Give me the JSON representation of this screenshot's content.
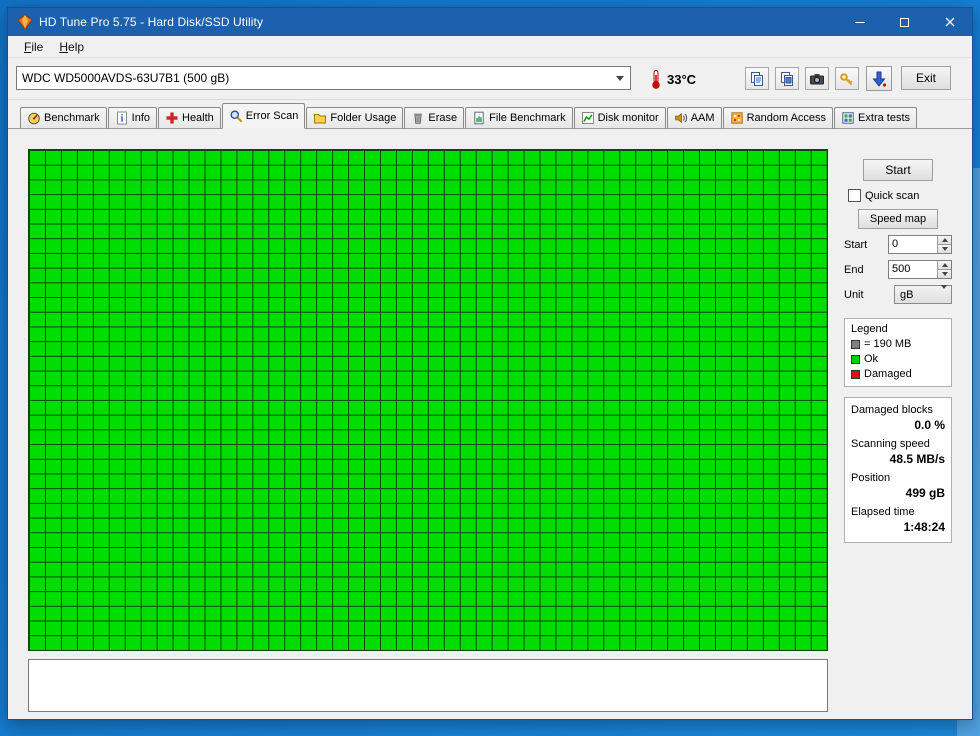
{
  "window": {
    "title": "HD Tune Pro 5.75 - Hard Disk/SSD Utility",
    "controls": [
      "minimize",
      "maximize",
      "close"
    ]
  },
  "menu": {
    "items": [
      {
        "label": "File"
      },
      {
        "label": "Help"
      }
    ]
  },
  "toolbar": {
    "drive_select_value": "WDC WD5000AVDS-63U7B1 (500 gB)",
    "temperature": "33°C",
    "icon_buttons": [
      "copy-text-icon",
      "copy-image-icon",
      "camera-icon",
      "key-icon",
      "download-arrow-icon"
    ],
    "exit_label": "Exit"
  },
  "tabs": [
    {
      "label": "Benchmark",
      "icon": "benchmark-icon",
      "active": false
    },
    {
      "label": "Info",
      "icon": "info-icon",
      "active": false
    },
    {
      "label": "Health",
      "icon": "health-icon",
      "active": false
    },
    {
      "label": "Error Scan",
      "icon": "error-scan-icon",
      "active": true
    },
    {
      "label": "Folder Usage",
      "icon": "folder-icon",
      "active": false
    },
    {
      "label": "Erase",
      "icon": "erase-icon",
      "active": false
    },
    {
      "label": "File Benchmark",
      "icon": "file-benchmark-icon",
      "active": false
    },
    {
      "label": "Disk monitor",
      "icon": "disk-monitor-icon",
      "active": false
    },
    {
      "label": "AAM",
      "icon": "speaker-icon",
      "active": false
    },
    {
      "label": "Random Access",
      "icon": "random-access-icon",
      "active": false
    },
    {
      "label": "Extra tests",
      "icon": "extra-tests-icon",
      "active": false
    }
  ],
  "scan_controls": {
    "start_button": "Start",
    "quick_scan_label": "Quick scan",
    "quick_scan_checked": false,
    "speed_map_button": "Speed map",
    "range_start_label": "Start",
    "range_start_value": "0",
    "range_end_label": "End",
    "range_end_value": "500",
    "unit_label": "Unit",
    "unit_value": "gB"
  },
  "legend": {
    "title": "Legend",
    "items": [
      {
        "label": "= 190 MB",
        "color": "#808080"
      },
      {
        "label": "Ok",
        "color": "#00cc00"
      },
      {
        "label": "Damaged",
        "color": "#dd1111"
      }
    ]
  },
  "status": {
    "damaged_blocks_label": "Damaged blocks",
    "damaged_blocks_value": "0.0 %",
    "scanning_speed_label": "Scanning speed",
    "scanning_speed_value": "48.5 MB/s",
    "position_label": "Position",
    "position_value": "499 gB",
    "elapsed_time_label": "Elapsed time",
    "elapsed_time_value": "1:48:24"
  },
  "scan_grid": {
    "columns": 50,
    "rows": 34,
    "ok_color": "#00dd00",
    "line_color": "#064806",
    "all_blocks_status": "ok",
    "damaged_blocks": 0
  }
}
